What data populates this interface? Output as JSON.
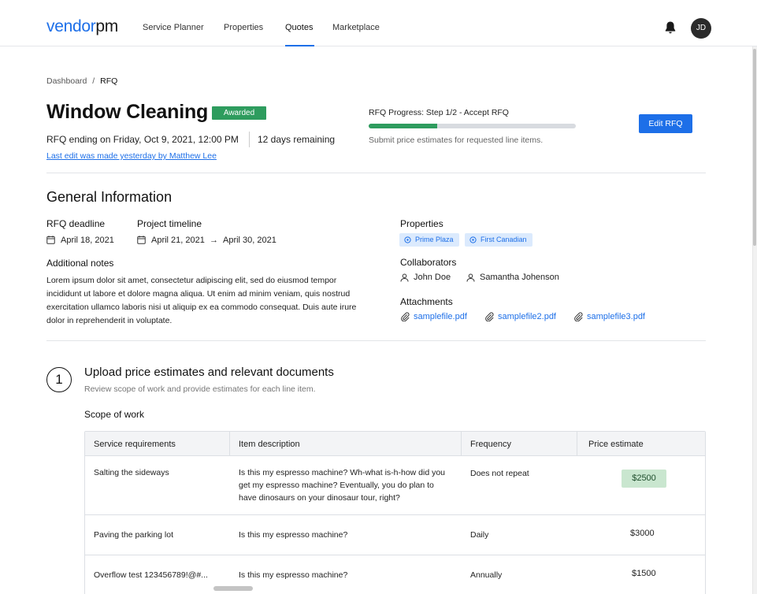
{
  "brand": {
    "logo_v": "vendor",
    "logo_pm": "pm"
  },
  "nav": {
    "items": [
      {
        "label": "Service Planner"
      },
      {
        "label": "Properties"
      },
      {
        "label": "Quotes"
      },
      {
        "label": "Marketplace"
      }
    ],
    "active": "Quotes",
    "avatar_initials": "JD"
  },
  "breadcrumb": {
    "root": "Dashboard",
    "sep": "/",
    "current": "RFQ"
  },
  "header": {
    "title": "Window Cleaning",
    "status_badge": "Awarded",
    "rfq_ending": "RFQ ending on Friday, Oct 9, 2021, 12:00 PM",
    "days_remaining": "12 days remaining",
    "last_edit": "Last edit was made yesterday by Matthew Lee",
    "progress_label": "RFQ Progress: Step 1/2 - Accept RFQ",
    "progress_value": 0.33,
    "progress_sub": "Submit price estimates for requested line items.",
    "edit_button": "Edit RFQ"
  },
  "general": {
    "title": "General Information",
    "deadline_label": "RFQ deadline",
    "deadline_value": "April 18, 2021",
    "timeline_label": "Project timeline",
    "timeline_start": "April 21, 2021",
    "timeline_arrow": "→",
    "timeline_end": "April 30, 2021",
    "notes_label": "Additional notes",
    "notes": "Lorem ipsum dolor sit amet, consectetur adipiscing elit, sed do eiusmod tempor incididunt ut labore et dolore magna aliqua. Ut enim ad minim veniam, quis nostrud exercitation ullamco laboris nisi ut aliquip ex ea commodo consequat. Duis aute irure dolor in reprehenderit in voluptate.",
    "properties_label": "Properties",
    "properties": [
      "Prime Plaza",
      "First Canadian"
    ],
    "collaborators_label": "Collaborators",
    "collaborators": [
      "John Doe",
      "Samantha Johenson"
    ],
    "attachments_label": "Attachments",
    "attachments": [
      "samplefile.pdf",
      "samplefile2.pdf",
      "samplefile3.pdf"
    ]
  },
  "step": {
    "number": "1",
    "title": "Upload price estimates and relevant documents",
    "subtitle": "Review scope of work and provide estimates for each line item.",
    "scope_label": "Scope of work"
  },
  "table": {
    "headers": [
      "Service requirements",
      "Item description",
      "Frequency",
      "Price estimate"
    ],
    "rows": [
      {
        "service": "Salting the sideways",
        "description": "Is this my espresso machine? Wh-what is-h-how did you get my espresso machine? Eventually, you do plan to have dinosaurs on your dinosaur tour, right?",
        "frequency": "Does not repeat",
        "price": "$2500"
      },
      {
        "service": "Paving the parking lot",
        "description": "Is this my espresso machine?",
        "frequency": "Daily",
        "price": "$3000"
      },
      {
        "service": "Overflow test 123456789!@#...",
        "description": "Is this my espresso machine?",
        "frequency": "Annually",
        "price": "$1500"
      }
    ]
  },
  "colors": {
    "accent": "#1d6fe8",
    "success": "#2e9c5e",
    "chip_bg": "#dbeafd",
    "price_pill_bg": "#c9e6cf"
  }
}
